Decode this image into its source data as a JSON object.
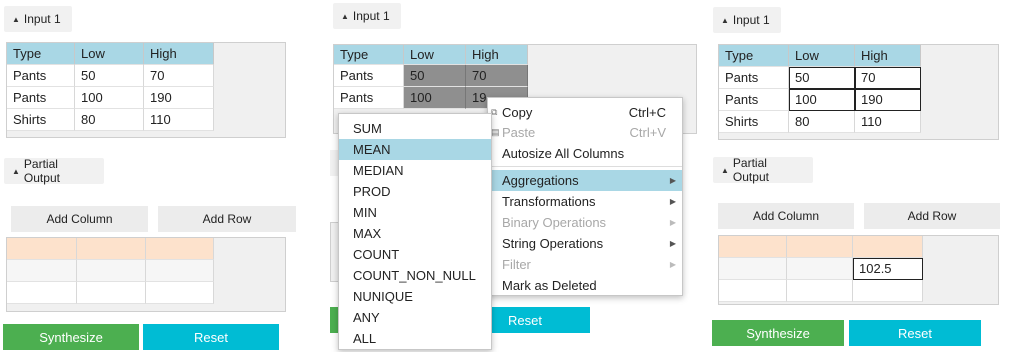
{
  "input_toggle": "Input 1",
  "partial_toggle": "Partial Output",
  "columns": [
    "Type",
    "Low",
    "High"
  ],
  "rows": [
    [
      "Pants",
      "50",
      "70"
    ],
    [
      "Pants",
      "100",
      "190"
    ],
    [
      "Shirts",
      "80",
      "110"
    ]
  ],
  "rows_panel2": [
    [
      "Pants",
      "50",
      "70"
    ],
    [
      "Pants",
      "100",
      "19"
    ]
  ],
  "add_column": "Add Column",
  "add_row": "Add Row",
  "synthesize": "Synthesize",
  "reset": "Reset",
  "output_value": "102.5",
  "context_menu": [
    {
      "label": "Copy",
      "shortcut": "Ctrl+C",
      "icon": "copy-icon",
      "disabled": false
    },
    {
      "label": "Paste",
      "shortcut": "Ctrl+V",
      "icon": "paste-icon",
      "disabled": true
    },
    {
      "label": "Autosize All Columns",
      "shortcut": "",
      "disabled": false
    },
    {
      "label": "Aggregations",
      "submenu": true,
      "disabled": false,
      "selected": true
    },
    {
      "label": "Transformations",
      "submenu": true,
      "disabled": false
    },
    {
      "label": "Binary Operations",
      "submenu": true,
      "disabled": true
    },
    {
      "label": "String Operations",
      "submenu": true,
      "disabled": false
    },
    {
      "label": "Filter",
      "submenu": true,
      "disabled": true
    },
    {
      "label": "Mark as Deleted",
      "disabled": false
    }
  ],
  "aggregations": [
    "SUM",
    "MEAN",
    "MEDIAN",
    "PROD",
    "MIN",
    "MAX",
    "COUNT",
    "COUNT_NON_NULL",
    "NUNIQUE",
    "ANY",
    "ALL"
  ],
  "aggregation_selected": "MEAN",
  "colors": {
    "header": "#a9d7e5",
    "output_row": "#fde2cc",
    "green": "#4caf50",
    "cyan": "#00bcd4"
  }
}
